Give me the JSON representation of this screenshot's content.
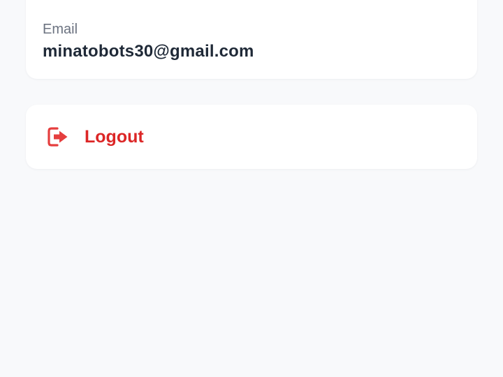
{
  "account": {
    "email_label": "Email",
    "email_value": "minatobots30@gmail.com"
  },
  "logout": {
    "label": "Logout",
    "icon": "logout-icon",
    "color": "#dc2626"
  },
  "colors": {
    "background": "#f8f9fb",
    "card": "#ffffff",
    "label": "#6b7280",
    "value": "#1f2937"
  }
}
